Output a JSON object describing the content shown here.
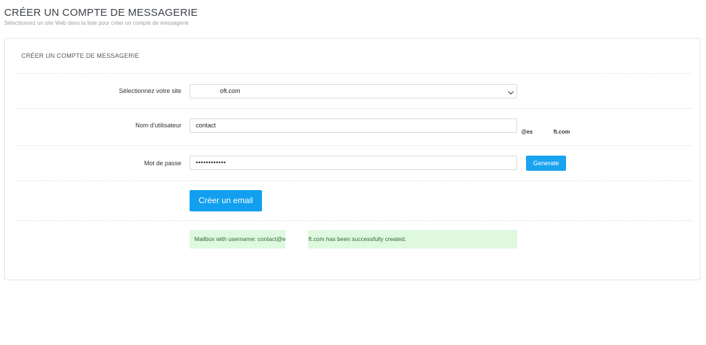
{
  "header": {
    "title": "CRÉER UN COMPTE DE MESSAGERIE",
    "subtitle": "Sélectionnez un site Web dans la liste pour créer un compte de messagerie"
  },
  "form": {
    "panel_title": "CRÉER UN COMPTE DE MESSAGERIE",
    "site": {
      "label": "Sélectionnez votre site",
      "value": "oft.com"
    },
    "username": {
      "label": "Nom d'utilisateur",
      "value": "contact",
      "domain_prefix": "@es",
      "domain_suffix": "ft.com"
    },
    "password": {
      "label": "Mot de passe",
      "value": "••••••••••••",
      "generate_label": "Generate"
    },
    "submit_label": "Créer un email"
  },
  "alert": {
    "message_start": "Mailbox with username: contact@e",
    "message_end": "ft.com has been successfully created."
  },
  "colors": {
    "accent": "#129ff0",
    "success_bg": "#dff8e0",
    "success_text": "#2f6b30"
  }
}
